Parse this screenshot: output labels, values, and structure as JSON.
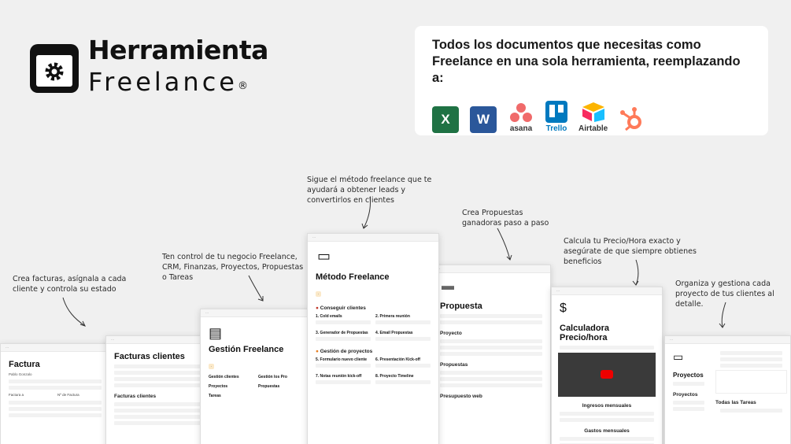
{
  "logo": {
    "line1": "Herramienta",
    "line2": "Freelance",
    "registered": "®"
  },
  "banner": {
    "text": "Todos los documentos que necesitas como Freelance en una sola herramienta, reemplazando a:",
    "apps": [
      {
        "name": "excel-icon",
        "label": "",
        "glyph": "X",
        "color": "#1f7244"
      },
      {
        "name": "word-icon",
        "label": "",
        "glyph": "W",
        "color": "#2b579a"
      },
      {
        "name": "asana-icon",
        "label": "asana",
        "glyph": "",
        "color": "#f06a6a"
      },
      {
        "name": "trello-icon",
        "label": "Trello",
        "glyph": "",
        "color": "#0079bf"
      },
      {
        "name": "airtable-icon",
        "label": "Airtable",
        "glyph": "",
        "color": "#18bfff"
      },
      {
        "name": "hubspot-icon",
        "label": "",
        "glyph": "",
        "color": "#ff7a59"
      }
    ]
  },
  "notes": {
    "facturas": "Crea facturas, asígnala a cada cliente y controla su estado",
    "control": "Ten control de tu negocio Freelance, CRM, Finanzas, Proyectos, Propuestas o Tareas",
    "metodo": "Sigue el método freelance que te ayudará a obtener leads y convertirlos en clientes",
    "propuestas": "Crea Propuestas ganadoras paso a paso",
    "precio": "Calcula tu Precio/Hora exacto y asegúrate de que siempre obtienes beneficios",
    "organiza": "Organiza y gestiona cada proyecto de tus clientes al detalle."
  },
  "cards": {
    "factura": {
      "title": "Factura",
      "client": "Pablo Gonzalo",
      "label1": "Factura a",
      "label2": "Nº de Factura"
    },
    "facturas_clientes": {
      "title": "Facturas clientes",
      "sub": "Facturas clientes"
    },
    "gestion": {
      "title": "Gestión Freelance",
      "s1": "Gestión clientes",
      "s2": "Gestión los Pro",
      "s3": "Proyectos",
      "s4": "Propuestas",
      "s5": "Tareas"
    },
    "metodo": {
      "title": "Método Freelance",
      "sec1": "Conseguir clientes",
      "c1": "1. Cold emails",
      "c2": "2. Primera reunión",
      "c3": "3. Generador de Propuestas",
      "c4": "4. Email Propuestas",
      "sec2": "Gestión de proyectos",
      "c5": "5. Formulario nuevo cliente",
      "c6": "6. Presentación Kick-off",
      "c7": "7. Notas reunión kick-off",
      "c8": "8. Proyecto Timeline"
    },
    "propuesta": {
      "title": "Propuesta",
      "p1": "Proyecto",
      "p2": "Propuestas",
      "p3": "Presupuesto web"
    },
    "calculadora": {
      "title": "Calculadora Precio/hora",
      "t1": "Ingresos mensuales",
      "t2": "Gastos mensuales"
    },
    "proyectos": {
      "title": "Proyectos",
      "s1": "Proyectos",
      "s2": "Todas las Tareas"
    }
  }
}
